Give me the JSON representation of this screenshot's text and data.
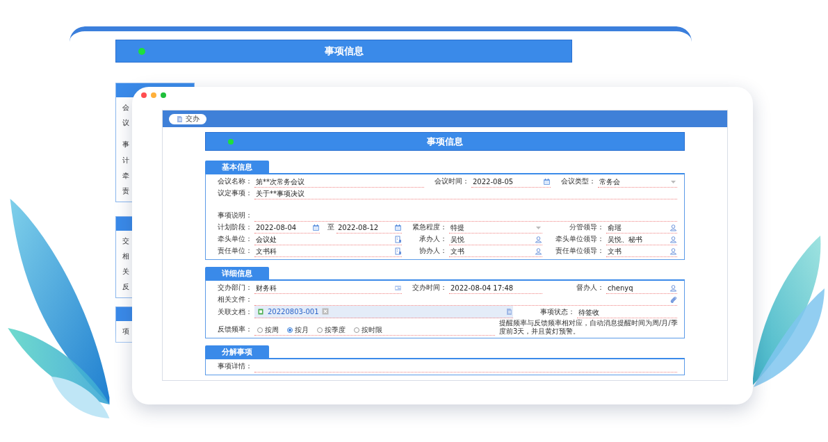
{
  "back_window": {
    "header": {
      "title": "事项信息"
    },
    "sections": [
      {
        "labels": [
          "会",
          "议",
          "事",
          "计",
          "牵",
          "责"
        ]
      },
      {
        "labels": [
          "交",
          "相",
          "关",
          "反"
        ]
      },
      {
        "labels": [
          "项"
        ]
      }
    ]
  },
  "front_window": {
    "toolbar": {
      "buttons": [
        {
          "label": "交办"
        }
      ]
    },
    "header": {
      "title": "事项信息"
    },
    "sections": [
      {
        "title": "基本信息",
        "rows": [
          {
            "fields": [
              {
                "label": "会议名称：",
                "value": "第**次常务会议",
                "kind": "text"
              },
              {
                "label": "会议时间：",
                "value": "2022-08-05",
                "kind": "date"
              },
              {
                "label": "会议类型：",
                "value": "常务会",
                "kind": "select"
              }
            ]
          },
          {
            "fields": [
              {
                "label": "议定事项：",
                "value": "关于**事项决议",
                "kind": "text"
              }
            ]
          },
          {
            "fields": [
              {
                "label": "事项说明：",
                "kind": "textarea"
              }
            ]
          },
          {
            "fields": [
              {
                "label": "计划阶段：",
                "value": "2022-08-04",
                "kind": "date"
              },
              {
                "label": "至",
                "value": "2022-08-12",
                "kind": "date"
              },
              {
                "label": "紧急程度：",
                "value": "特提",
                "kind": "select"
              },
              {
                "label": "分管领导：",
                "value": "俞瑶",
                "kind": "person"
              }
            ]
          },
          {
            "fields": [
              {
                "label": "牵头单位：",
                "value": "会议处",
                "kind": "org"
              },
              {
                "label": "承办人：",
                "value": "吴悦",
                "kind": "person"
              },
              {
                "label": "牵头单位领导：",
                "value": "吴悦、秘书",
                "kind": "person"
              }
            ]
          },
          {
            "fields": [
              {
                "label": "责任单位：",
                "value": "文书科",
                "kind": "org"
              },
              {
                "label": "协办人：",
                "value": "文书",
                "kind": "person"
              },
              {
                "label": "责任单位领导：",
                "value": "文书",
                "kind": "person"
              }
            ]
          }
        ]
      },
      {
        "title": "详细信息",
        "rows": [
          {
            "fields": [
              {
                "label": "交办部门：",
                "value": "财务科",
                "kind": "dept"
              },
              {
                "label": "交办时间：",
                "value": "2022-08-04 17:48",
                "kind": "text"
              },
              {
                "label": "督办人：",
                "value": "chenyq",
                "kind": "person"
              }
            ]
          },
          {
            "fields": [
              {
                "label": "相关文件：",
                "kind": "attach"
              }
            ]
          },
          {
            "fields": [
              {
                "label": "关联文档：",
                "kind": "files",
                "files": [
                  {
                    "name": "20220803-001"
                  }
                ]
              },
              {
                "label": "事项状态：",
                "value": "待签收",
                "kind": "text"
              }
            ]
          },
          {
            "fields": [
              {
                "label": "反馈频率：",
                "kind": "radio",
                "options": [
                  {
                    "label": "按周",
                    "selected": false
                  },
                  {
                    "label": "按月",
                    "selected": true
                  },
                  {
                    "label": "按季度",
                    "selected": false
                  },
                  {
                    "label": "按时限",
                    "selected": false
                  }
                ]
              },
              {
                "kind": "note",
                "value": "提醒频率与反馈频率相对应，自动消息提醒时间为周/月/季度前3天，并且黄灯预警。"
              }
            ]
          }
        ]
      },
      {
        "title": "分解事项",
        "rows": [
          {
            "fields": [
              {
                "label": "事项详情：",
                "kind": "text"
              }
            ]
          }
        ]
      }
    ]
  }
}
